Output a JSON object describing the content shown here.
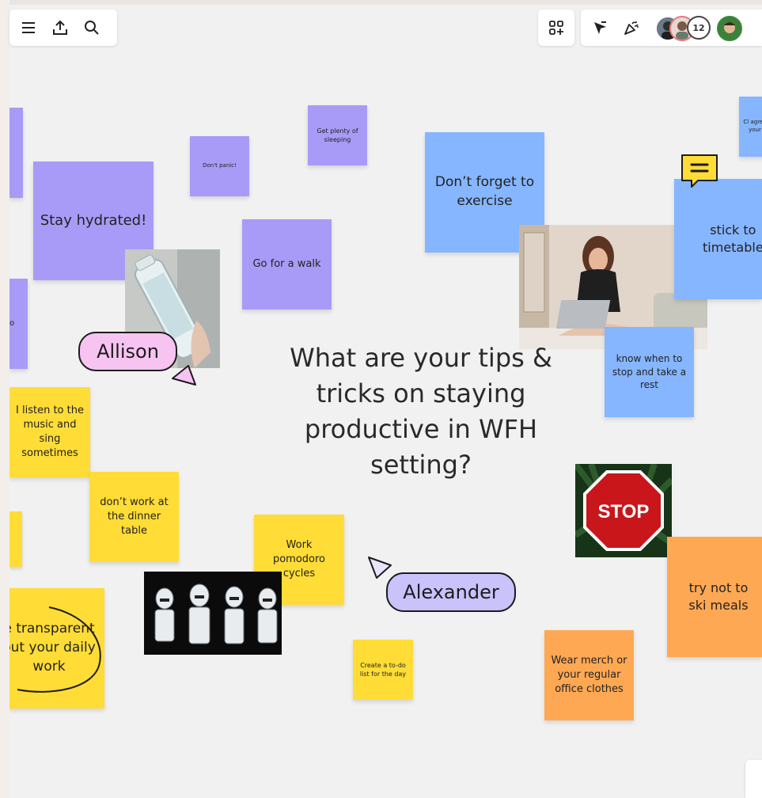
{
  "toolbar": {
    "left_icons": [
      "menu-icon",
      "upload-icon",
      "search-icon"
    ],
    "right_icons": [
      "shapes-add-icon",
      "cursor-select-icon",
      "celebrate-icon"
    ],
    "collaborator_count": "12"
  },
  "board": {
    "question": "What are your tips & tricks on staying productive in WFH setting?",
    "cursors": {
      "allison": "Allison",
      "alexander": "Alexander"
    },
    "notes": {
      "stay_hydrated": "Stay hydrated!",
      "dont_panic": "Don't panic!",
      "get_plenty_sleeping": "Get plenty of sleeping",
      "go_for_walk": "Go for a walk",
      "dont_forget_exercise": "Don’t forget to exercise",
      "stick_timetable": "stick to timetable",
      "top_right_partial": "Cl agree your",
      "left_partial": "o",
      "know_when_stop": "know when to stop and take a rest",
      "listen_music": "I listen to the music and sing sometimes",
      "dont_work_dinner": "don’t work at the dinner table",
      "work_pomodoro": "Work pomodoro cycles",
      "be_transparent": "e transparent out your daily work",
      "create_todo": "Create a to-do list for the day",
      "wear_merch": "Wear merch or your regular office clothes",
      "try_not_skip": "try not to ski meals"
    },
    "stop_sign": "STOP"
  },
  "colors": {
    "purple": "#a89bf7",
    "blue": "#86b6ff",
    "yellow": "#ffdc36",
    "orange": "#ffa853",
    "allison_tag": "#f7c4f2",
    "alexander_tag": "#c9c2fb"
  }
}
